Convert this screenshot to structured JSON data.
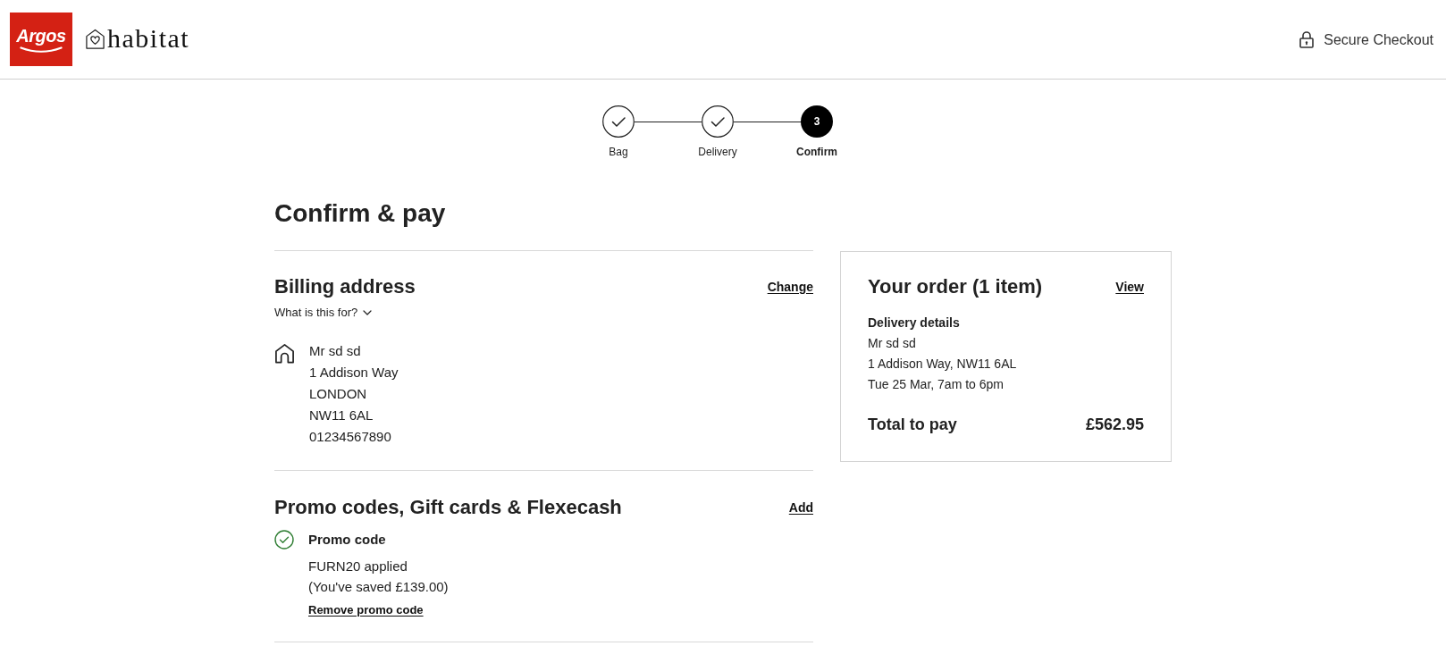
{
  "header": {
    "logo": "Argos",
    "partner_logo": "habitat",
    "secure_label": "Secure Checkout"
  },
  "steps": [
    {
      "label": "Bag",
      "kind": "done"
    },
    {
      "label": "Delivery",
      "kind": "done"
    },
    {
      "label": "Confirm",
      "kind": "current",
      "number": "3"
    }
  ],
  "page_title": "Confirm & pay",
  "billing": {
    "title": "Billing address",
    "action": "Change",
    "help": {
      "label": "What is this for?",
      "expanded": false
    },
    "address_lines": [
      "Mr sd sd",
      "1 Addison Way",
      "LONDON",
      "NW11 6AL",
      "01234567890"
    ]
  },
  "promo": {
    "title": "Promo codes, Gift cards & Flexecash",
    "action": "Add",
    "applied": {
      "title": "Promo code",
      "lines": [
        "FURN20 applied",
        "(You've saved £139.00)"
      ],
      "link": "Remove promo code"
    }
  },
  "order_summary": {
    "title": "Your order (1 item)",
    "action": "View",
    "delivery_title": "Delivery details",
    "delivery_lines": [
      "Mr sd sd",
      "1 Addison Way, NW11 6AL",
      "Tue 25 Mar, 7am to 6pm"
    ],
    "total_label": "Total to pay",
    "total_value": "£562.95"
  }
}
